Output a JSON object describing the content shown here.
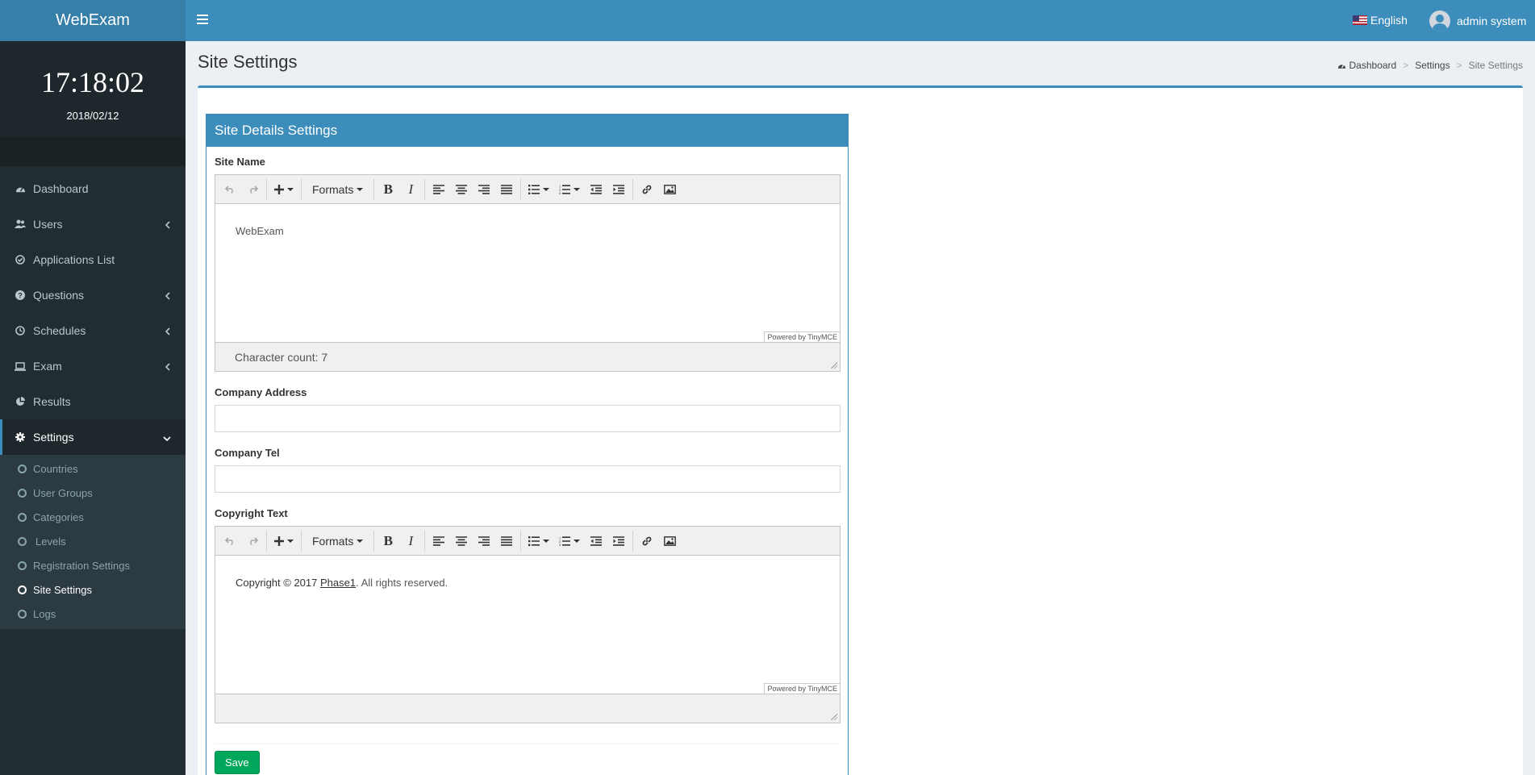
{
  "app": {
    "title": "WebExam"
  },
  "clock": {
    "time": "17:18:02",
    "date": "2018/02/12"
  },
  "sidebar": {
    "items": [
      {
        "label": "Dashboard"
      },
      {
        "label": "Users"
      },
      {
        "label": "Applications List"
      },
      {
        "label": "Questions"
      },
      {
        "label": "Schedules"
      },
      {
        "label": "Exam"
      },
      {
        "label": "Results"
      },
      {
        "label": "Settings"
      }
    ],
    "settings_sub": [
      {
        "label": "Countries"
      },
      {
        "label": "User Groups"
      },
      {
        "label": "Categories"
      },
      {
        "label": "Levels"
      },
      {
        "label": "Registration Settings"
      },
      {
        "label": "Site Settings"
      },
      {
        "label": "Logs"
      }
    ]
  },
  "header": {
    "language": "English",
    "user": "admin system"
  },
  "page": {
    "title": "Site Settings",
    "breadcrumb": [
      "Dashboard",
      "Settings",
      "Site Settings"
    ]
  },
  "form": {
    "panel_title": "Site Details Settings",
    "site_name": {
      "label": "Site Name",
      "content": "WebExam",
      "char_count": "Character count: 7"
    },
    "company_address": {
      "label": "Company Address",
      "value": ""
    },
    "company_tel": {
      "label": "Company Tel",
      "value": ""
    },
    "copyright": {
      "label": "Copyright Text",
      "prefix": "Copyright © 2017 ",
      "link": "Phase1",
      "suffix": ". All rights reserved."
    },
    "editor_formats": "Formats",
    "editor_powered": "Powered by TinyMCE",
    "save_label": "Save"
  },
  "colors": {
    "brand": "#3c8dbc",
    "sidebar": "#222d32",
    "save": "#00a65a"
  }
}
